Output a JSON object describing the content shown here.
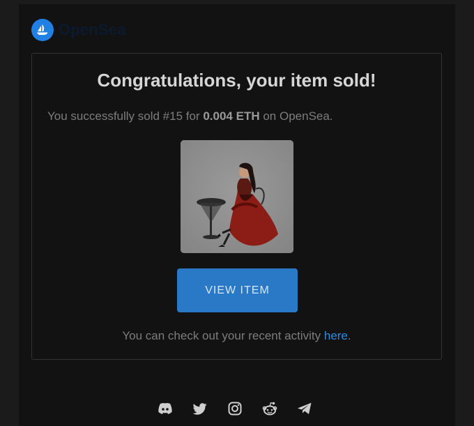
{
  "brand": {
    "name": "OpenSea",
    "logo_icon": "sailboat-icon"
  },
  "card": {
    "headline": "Congratulations, your item sold!",
    "sold_prefix": "You successfully sold #15 for",
    "price": "0.004 ETH",
    "sold_suffix": "on OpenSea.",
    "button_label": "VIEW ITEM",
    "activity_prefix": "You can check out your recent activity",
    "activity_link": "here",
    "activity_suffix": "."
  },
  "footer": {
    "social_icons": [
      "discord-icon",
      "twitter-icon",
      "instagram-icon",
      "reddit-icon",
      "telegram-icon"
    ]
  },
  "colors": {
    "accent": "#2081e2",
    "button": "#2979c6",
    "link": "#2f8ae6",
    "background": "#121212"
  }
}
